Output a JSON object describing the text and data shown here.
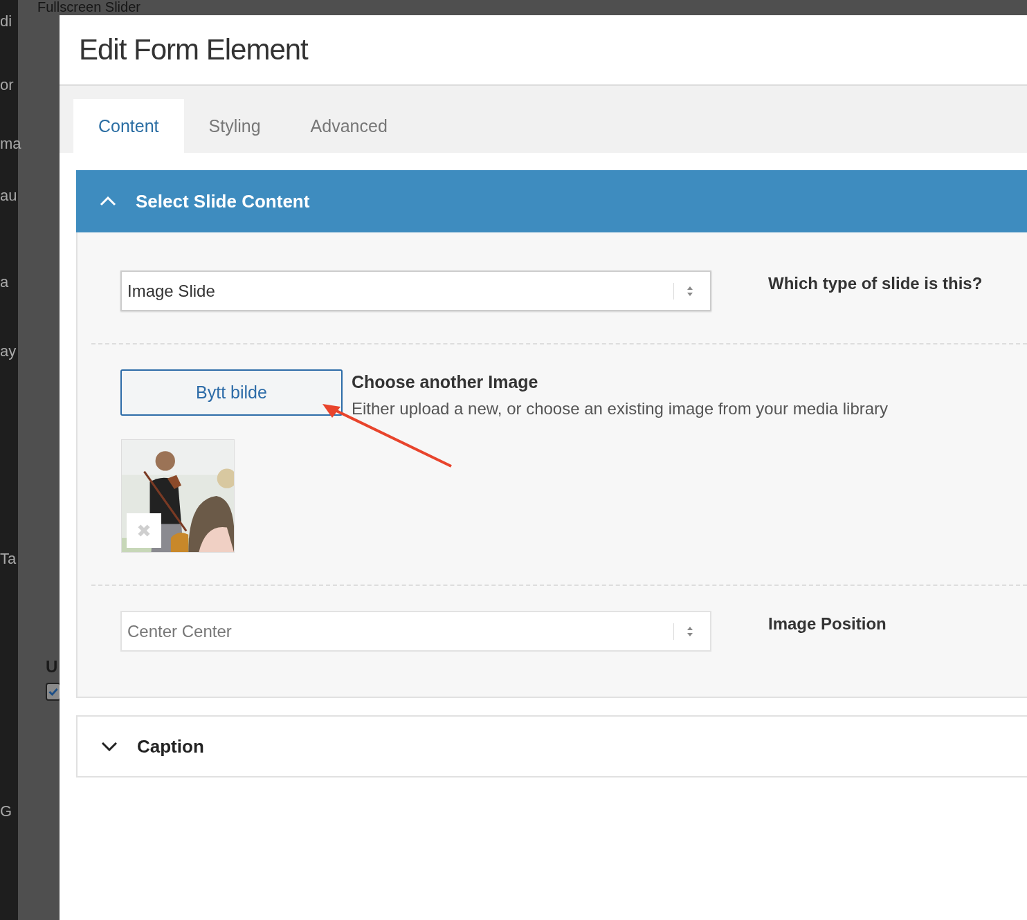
{
  "background": {
    "title": "Fullscreen Slider",
    "fragments": [
      "di",
      "or",
      "ma",
      "au",
      "a",
      "ay",
      "Ta",
      "G"
    ],
    "letter": "U",
    "checkbox": {
      "checked": true
    }
  },
  "dialog": {
    "title": "Edit Form Element",
    "tabs": [
      {
        "label": "Content",
        "selected": true
      },
      {
        "label": "Styling",
        "selected": false
      },
      {
        "label": "Advanced",
        "selected": false
      }
    ],
    "sections": [
      {
        "title": "Select Slide Content",
        "expanded": true,
        "fields": [
          {
            "kind": "select",
            "value": "Image Slide",
            "muted": false,
            "label": "Which type of slide is this?"
          },
          {
            "button": "Bytt bilde",
            "label": "Choose another Image",
            "description": "Either upload a new, or choose an existing image from your media library"
          },
          {
            "kind": "select",
            "value": "Center Center",
            "muted": true,
            "label": "Image Position"
          }
        ]
      },
      {
        "title": "Caption",
        "expanded": false
      }
    ]
  }
}
